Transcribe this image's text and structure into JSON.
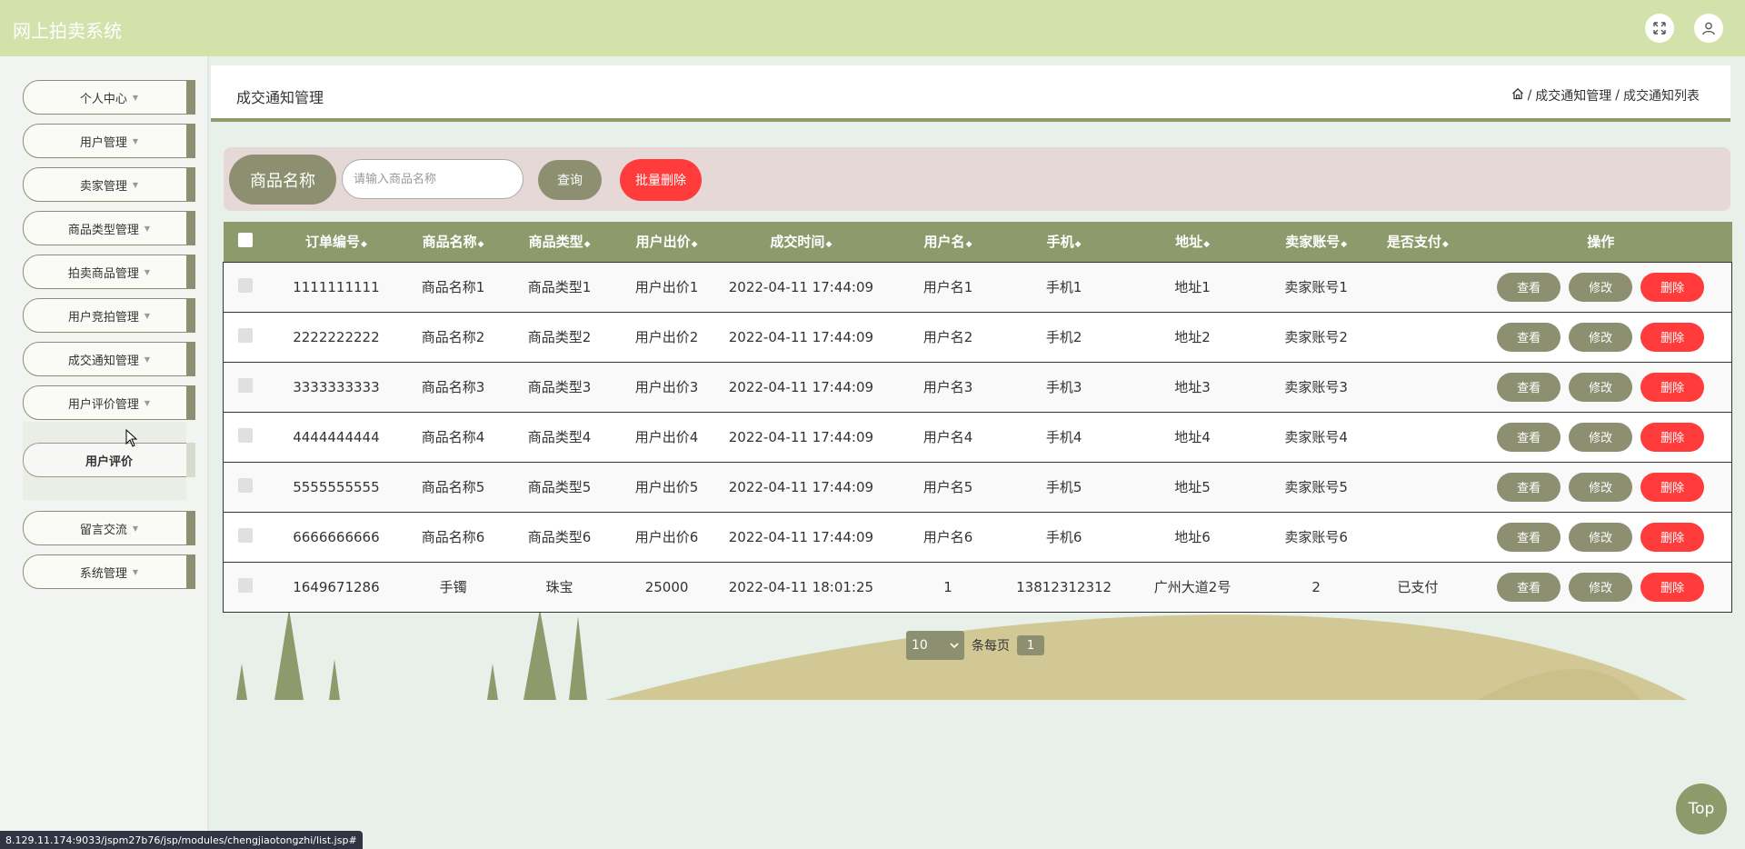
{
  "app": {
    "title": "网上拍卖系统"
  },
  "header_icons": [
    "fullscreen-icon",
    "user-icon"
  ],
  "sidebar": {
    "items": [
      {
        "label": "个人中心"
      },
      {
        "label": "用户管理"
      },
      {
        "label": "卖家管理"
      },
      {
        "label": "商品类型管理"
      },
      {
        "label": "拍卖商品管理"
      },
      {
        "label": "用户竞拍管理"
      },
      {
        "label": "成交通知管理"
      },
      {
        "label": "用户评价管理"
      },
      {
        "label": "留言交流"
      },
      {
        "label": "系统管理"
      }
    ],
    "sub_item": {
      "label": "用户评价"
    }
  },
  "page": {
    "title": "成交通知管理",
    "breadcrumb": [
      "成交通知管理",
      "成交通知列表"
    ],
    "breadcrumb_sep": "/"
  },
  "search": {
    "label": "商品名称",
    "placeholder": "请输入商品名称",
    "query_label": "查询",
    "batch_delete_label": "批量删除"
  },
  "table": {
    "columns": [
      "订单编号",
      "商品名称",
      "商品类型",
      "用户出价",
      "成交时间",
      "用户名",
      "手机",
      "地址",
      "卖家账号",
      "是否支付",
      "操作"
    ],
    "rows": [
      [
        "1111111111",
        "商品名称1",
        "商品类型1",
        "用户出价1",
        "2022-04-11 17:44:09",
        "用户名1",
        "手机1",
        "地址1",
        "卖家账号1",
        ""
      ],
      [
        "2222222222",
        "商品名称2",
        "商品类型2",
        "用户出价2",
        "2022-04-11 17:44:09",
        "用户名2",
        "手机2",
        "地址2",
        "卖家账号2",
        ""
      ],
      [
        "3333333333",
        "商品名称3",
        "商品类型3",
        "用户出价3",
        "2022-04-11 17:44:09",
        "用户名3",
        "手机3",
        "地址3",
        "卖家账号3",
        ""
      ],
      [
        "4444444444",
        "商品名称4",
        "商品类型4",
        "用户出价4",
        "2022-04-11 17:44:09",
        "用户名4",
        "手机4",
        "地址4",
        "卖家账号4",
        ""
      ],
      [
        "5555555555",
        "商品名称5",
        "商品类型5",
        "用户出价5",
        "2022-04-11 17:44:09",
        "用户名5",
        "手机5",
        "地址5",
        "卖家账号5",
        ""
      ],
      [
        "6666666666",
        "商品名称6",
        "商品类型6",
        "用户出价6",
        "2022-04-11 17:44:09",
        "用户名6",
        "手机6",
        "地址6",
        "卖家账号6",
        ""
      ],
      [
        "1649671286",
        "手镯",
        "珠宝",
        "25000",
        "2022-04-11 18:01:25",
        "1",
        "13812312312",
        "广州大道2号",
        "2",
        "已支付"
      ]
    ],
    "actions": {
      "view": "查看",
      "edit": "修改",
      "delete": "删除"
    }
  },
  "pagination": {
    "page_size": "10",
    "per_page_label": "条每页",
    "current_page": "1"
  },
  "top_button": "Top",
  "status_url": "8.129.11.174:9033/jspm27b76/jsp/modules/chengjiaotongzhi/list.jsp#",
  "colors": {
    "header": "#d3e2ab",
    "accent": "#8c9070",
    "table_header": "#8c9a6c",
    "danger": "#ff3b3b",
    "search_bg": "#e6d8d6"
  }
}
